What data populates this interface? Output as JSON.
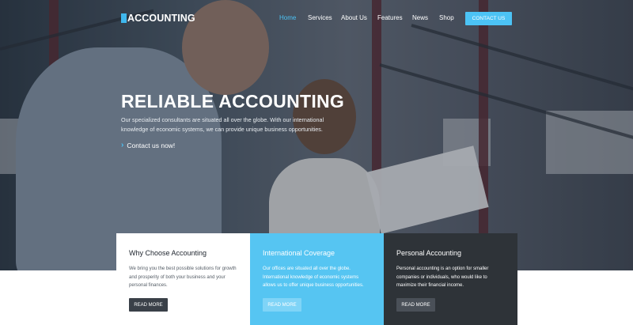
{
  "nav": {
    "logo_text": "ACCOUNTING",
    "items": [
      {
        "label": "Home"
      },
      {
        "label": "Services"
      },
      {
        "label": "About Us"
      },
      {
        "label": "Features"
      },
      {
        "label": "News"
      },
      {
        "label": "Shop"
      }
    ],
    "active_item": "Home",
    "contact_label": "CONTACT US"
  },
  "hero": {
    "headline": "RELIABLE ACCOUNTING",
    "subtext": "Our specialized consultants are situated all over the globe. With our international knowledge of economic systems, we can provide unique business opportunities.",
    "contact_link": "Contact us now!"
  },
  "cards": [
    {
      "title": "Why Choose Accounting",
      "text": "We bring you the best possible solutions for growth and prosperity of both your business and your personal finances.",
      "button": "READ MORE"
    },
    {
      "title": "International Coverage",
      "text": "Our offices are situated all over the globe. International knowledge of economic systems allows us to offer unique business opportunities.",
      "button": "READ MORE"
    },
    {
      "title": "Personal Accounting",
      "text": "Personal accounting is an option for smaller companies or individuals, who would like to maximize their financial income.",
      "button": "READ MORE"
    }
  ],
  "colors": {
    "accent": "#4cc3f5",
    "card_blue": "#56c5f2",
    "card_dark": "#2e3338"
  },
  "icons": {
    "link_chevron": "chevron-right-icon"
  }
}
